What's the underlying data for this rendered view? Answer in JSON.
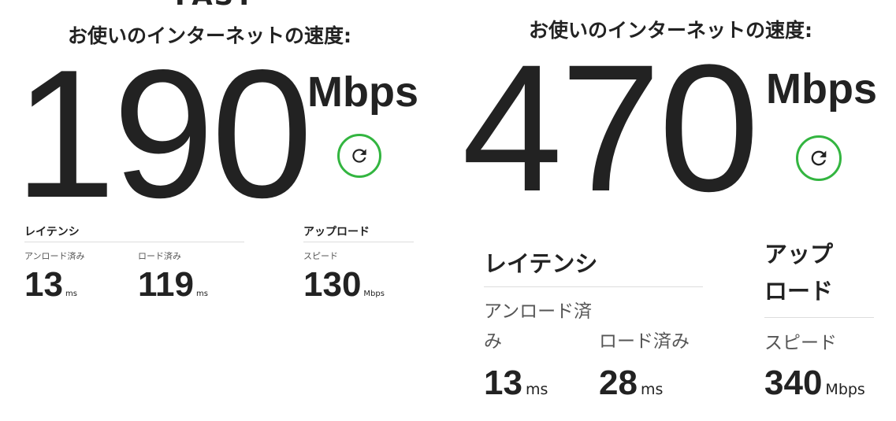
{
  "left": {
    "brand": "FAST",
    "title": "お使いのインターネットの速度:",
    "speed_value": "190",
    "speed_unit": "Mbps",
    "latency_heading": "レイテンシ",
    "unloaded_label": "アンロード済み",
    "unloaded_value": "13",
    "unloaded_unit": "ms",
    "loaded_label": "ロード済み",
    "loaded_value": "119",
    "loaded_unit": "ms",
    "upload_heading": "アップロード",
    "upload_speed_label": "スピード",
    "upload_value": "130",
    "upload_unit": "Mbps"
  },
  "right": {
    "title": "お使いのインターネットの速度:",
    "speed_value": "470",
    "speed_unit": "Mbps",
    "latency_heading": "レイテンシ",
    "unloaded_label": "アンロード済み",
    "unloaded_value": "13",
    "unloaded_unit": "ms",
    "loaded_label": "ロード済み",
    "loaded_value": "28",
    "loaded_unit": "ms",
    "upload_heading": "アップロード",
    "upload_speed_label": "スピード",
    "upload_value": "340",
    "upload_unit": "Mbps"
  },
  "icons": {
    "refresh": "refresh-icon"
  },
  "colors": {
    "text": "#222222",
    "accent_green": "#33b540",
    "subtext": "#555555",
    "rule": "#dddddd"
  }
}
